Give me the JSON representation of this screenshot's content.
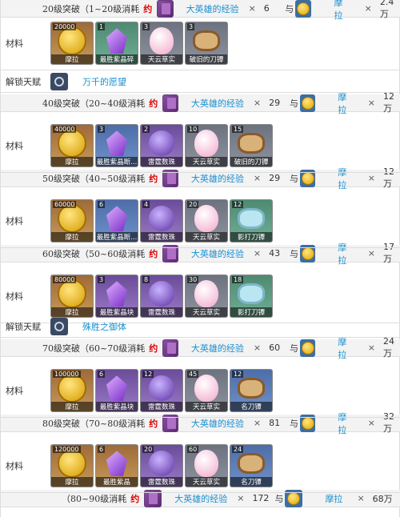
{
  "labels": {
    "materials": "材料",
    "unlock_talent": "解锁天赋",
    "approx": "约",
    "hero_exp": "大英雄的经验",
    "and": "与",
    "times": "×",
    "mora": "摩拉"
  },
  "stages": [
    {
      "title": "20级突破（1~20级消耗",
      "exp_count": "6",
      "mora_amount": "2.4万"
    },
    {
      "title": "40级突破（20~40级消耗",
      "exp_count": "29",
      "mora_amount": "12万"
    },
    {
      "title": "50级突破（40~50级消耗",
      "exp_count": "29",
      "mora_amount": "12万"
    },
    {
      "title": "60级突破（50~60级消耗",
      "exp_count": "43",
      "mora_amount": "17万"
    },
    {
      "title": "70级突破（60~70级消耗",
      "exp_count": "60",
      "mora_amount": "24万"
    },
    {
      "title": "80级突破（70~80级消耗",
      "exp_count": "81",
      "mora_amount": "32万"
    },
    {
      "title": "（80~90级消耗",
      "exp_count": "172",
      "mora_amount": "68万"
    }
  ],
  "materials": [
    [
      {
        "count": "20000",
        "name": "摩拉",
        "icon": "mora-coin-icon"
      },
      {
        "count": "1",
        "name": "最胜紫晶碎",
        "icon": "amethyst-sliver-icon"
      },
      {
        "count": "3",
        "name": "天云草实",
        "icon": "naku-weed-icon"
      },
      {
        "count": "3",
        "name": "破旧的刀镡",
        "icon": "old-handguard-icon"
      }
    ],
    [
      {
        "count": "40000",
        "name": "摩拉",
        "icon": "mora-coin-icon"
      },
      {
        "count": "3",
        "name": "最胜紫晶断...",
        "icon": "amethyst-fragment-icon"
      },
      {
        "count": "2",
        "name": "雷霆数珠",
        "icon": "thunder-prism-icon"
      },
      {
        "count": "10",
        "name": "天云草实",
        "icon": "naku-weed-icon"
      },
      {
        "count": "15",
        "name": "破旧的刀镡",
        "icon": "old-handguard-icon"
      }
    ],
    [
      {
        "count": "60000",
        "name": "摩拉",
        "icon": "mora-coin-icon"
      },
      {
        "count": "6",
        "name": "最胜紫晶断...",
        "icon": "amethyst-fragment-icon"
      },
      {
        "count": "4",
        "name": "雷霆数珠",
        "icon": "thunder-prism-icon"
      },
      {
        "count": "20",
        "name": "天云草实",
        "icon": "naku-weed-icon"
      },
      {
        "count": "12",
        "name": "影打刀镡",
        "icon": "kageuchi-handguard-icon"
      }
    ],
    [
      {
        "count": "80000",
        "name": "摩拉",
        "icon": "mora-coin-icon"
      },
      {
        "count": "3",
        "name": "最胜紫晶块",
        "icon": "amethyst-chunk-icon"
      },
      {
        "count": "8",
        "name": "雷霆数珠",
        "icon": "thunder-prism-icon"
      },
      {
        "count": "30",
        "name": "天云草实",
        "icon": "naku-weed-icon"
      },
      {
        "count": "18",
        "name": "影打刀镡",
        "icon": "kageuchi-handguard-icon"
      }
    ],
    [
      {
        "count": "100000",
        "name": "摩拉",
        "icon": "mora-coin-icon"
      },
      {
        "count": "6",
        "name": "最胜紫晶块",
        "icon": "amethyst-chunk-icon"
      },
      {
        "count": "12",
        "name": "雷霆数珠",
        "icon": "thunder-prism-icon"
      },
      {
        "count": "45",
        "name": "天云草实",
        "icon": "naku-weed-icon"
      },
      {
        "count": "12",
        "name": "名刀镡",
        "icon": "famed-handguard-icon"
      }
    ],
    [
      {
        "count": "120000",
        "name": "摩拉",
        "icon": "mora-coin-icon"
      },
      {
        "count": "6",
        "name": "最胜紫晶",
        "icon": "amethyst-gemstone-icon"
      },
      {
        "count": "20",
        "name": "雷霆数珠",
        "icon": "thunder-prism-icon"
      },
      {
        "count": "60",
        "name": "天云草实",
        "icon": "naku-weed-icon"
      },
      {
        "count": "24",
        "name": "名刀镡",
        "icon": "famed-handguard-icon"
      }
    ]
  ],
  "talents": [
    {
      "name": "万千的愿望",
      "icon": "talent-sparkle-icon"
    },
    {
      "name": "殊胜之御体",
      "icon": "talent-blade-icon"
    }
  ]
}
